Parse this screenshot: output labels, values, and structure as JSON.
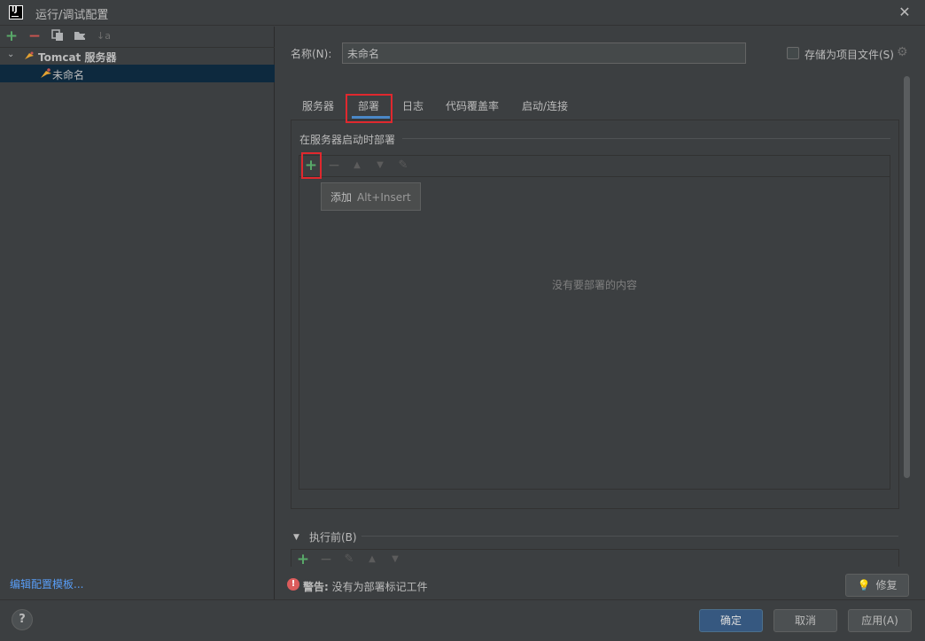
{
  "window": {
    "title": "运行/调试配置",
    "app_logo_text": "IJ"
  },
  "left_toolbar": {
    "icons": [
      "add-icon",
      "remove-icon",
      "copy-icon",
      "new-folder-icon",
      "sort-icon"
    ],
    "add_glyph": "+",
    "remove_glyph": "−",
    "sort_glyph": "↓a"
  },
  "tree": {
    "group_label": "Tomcat 服务器",
    "item_label": "未命名"
  },
  "edit_templates_link": "编辑配置模板...",
  "name": {
    "label": "名称(N):",
    "value": "未命名"
  },
  "store_as_project_file": {
    "label": "存储为项目文件(S)",
    "checked": false
  },
  "tabs": [
    {
      "label": "服务器"
    },
    {
      "label": "部署",
      "active": true
    },
    {
      "label": "日志"
    },
    {
      "label": "代码覆盖率"
    },
    {
      "label": "启动/连接"
    }
  ],
  "deploy_section": {
    "title": "在服务器启动时部署",
    "empty_text": "没有要部署的内容",
    "tooltip_label": "添加",
    "tooltip_shortcut": "Alt+Insert",
    "toolbar_glyphs": {
      "add": "+",
      "remove": "−",
      "up": "▲",
      "down": "▼",
      "edit": "✎"
    }
  },
  "before_launch": {
    "label": "执行前(B)"
  },
  "warning": {
    "prefix": "警告:",
    "text": " 没有为部署标记工件"
  },
  "fix_button": {
    "label": "修复"
  },
  "buttons": {
    "ok": "确定",
    "cancel": "取消",
    "apply": "应用(A)",
    "help": "?"
  },
  "colors": {
    "accent_blue": "#4a88c7",
    "add_green": "#59a869",
    "remove_red": "#c75450",
    "highlight_red": "#e0282e",
    "link_blue": "#589df6"
  }
}
